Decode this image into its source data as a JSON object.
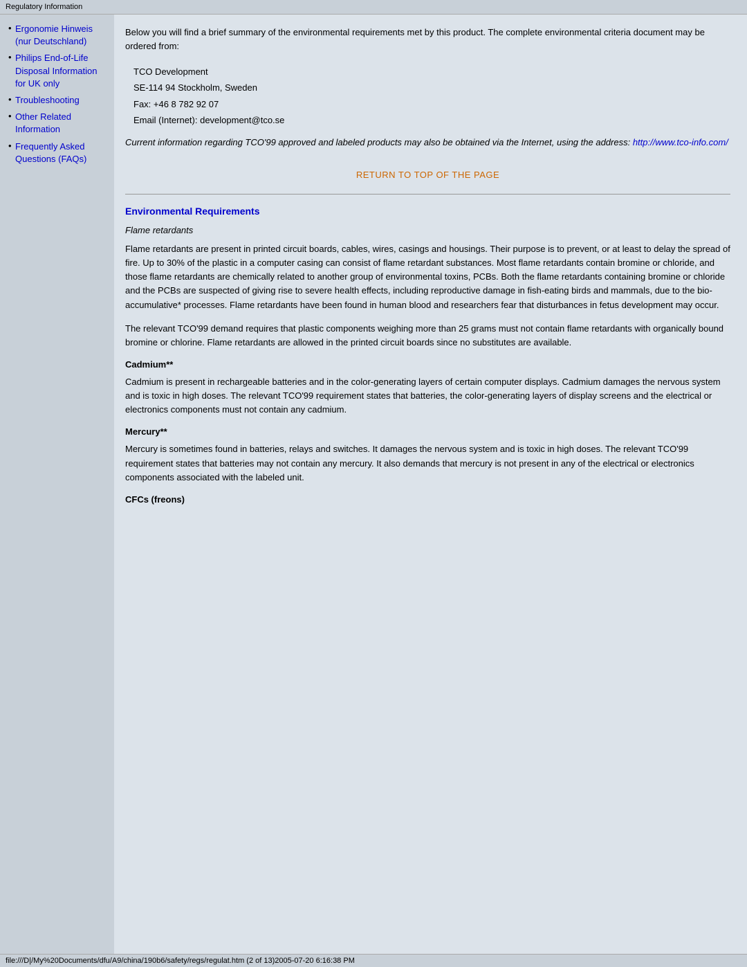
{
  "titleBar": {
    "text": "Regulatory Information"
  },
  "sidebar": {
    "items": [
      {
        "label": "Ergonomie Hinweis (nur Deutschland)",
        "href": "#"
      },
      {
        "label": "Philips End-of-Life Disposal Information for UK only",
        "href": "#"
      },
      {
        "label": "Troubleshooting",
        "href": "#"
      },
      {
        "label": "Other Related Information",
        "href": "#"
      },
      {
        "label": "Frequently Asked Questions (FAQs)",
        "href": "#"
      }
    ]
  },
  "content": {
    "introText": "Below you will find a brief summary of the environmental requirements met by this product. The complete environmental criteria document may be ordered from:",
    "addressLine1": "TCO Development",
    "addressLine2": "SE-114 94 Stockholm, Sweden",
    "addressLine3": "Fax: +46 8 782 92 07",
    "addressLine4": "Email (Internet): development@tco.se",
    "italicNote": "Current information regarding TCO'99 approved and labeled products may also be obtained via the Internet, using the address: ",
    "italicNoteLink": "http://www.tco-info.com/",
    "returnLink": "RETURN TO TOP OF THE PAGE",
    "envRequirementsHeading": "Environmental Requirements",
    "flameRetardantsSubheading": "Flame retardants",
    "flameRetardantsPara1": "Flame retardants are present in printed circuit boards, cables, wires, casings and housings. Their purpose is to prevent, or at least to delay the spread of fire. Up to 30% of the plastic in a computer casing can consist of flame retardant substances. Most flame retardants contain bromine or chloride, and those flame retardants are chemically related to another group of environmental toxins, PCBs. Both the flame retardants containing bromine or chloride and the PCBs are suspected of giving rise to severe health effects, including reproductive damage in fish-eating birds and mammals, due to the bio-accumulative* processes. Flame retardants have been found in human blood and researchers fear that disturbances in fetus development may occur.",
    "flameRetardantsPara2": "The relevant TCO'99 demand requires that plastic components weighing more than 25 grams must not contain flame retardants with organically bound bromine or chlorine. Flame retardants are allowed in the printed circuit boards since no substitutes are available.",
    "cadmiumHeading": "Cadmium**",
    "cadmiumPara": "Cadmium is present in rechargeable batteries and in the color-generating layers of certain computer displays. Cadmium damages the nervous system and is toxic in high doses. The relevant TCO'99 requirement states that batteries, the color-generating layers of display screens and the electrical or electronics components must not contain any cadmium.",
    "mercuryHeading": "Mercury**",
    "mercuryPara": "Mercury is sometimes found in batteries, relays and switches. It damages the nervous system and is toxic in high doses. The relevant TCO'99 requirement states that batteries may not contain any mercury. It also demands that mercury is not present in any of the electrical or electronics components associated with the labeled unit.",
    "cfcsHeading": "CFCs (freons)"
  },
  "statusBar": {
    "text": "file:///D|/My%20Documents/dfu/A9/china/190b6/safety/regs/regulat.htm (2 of 13)2005-07-20 6:16:38 PM"
  }
}
